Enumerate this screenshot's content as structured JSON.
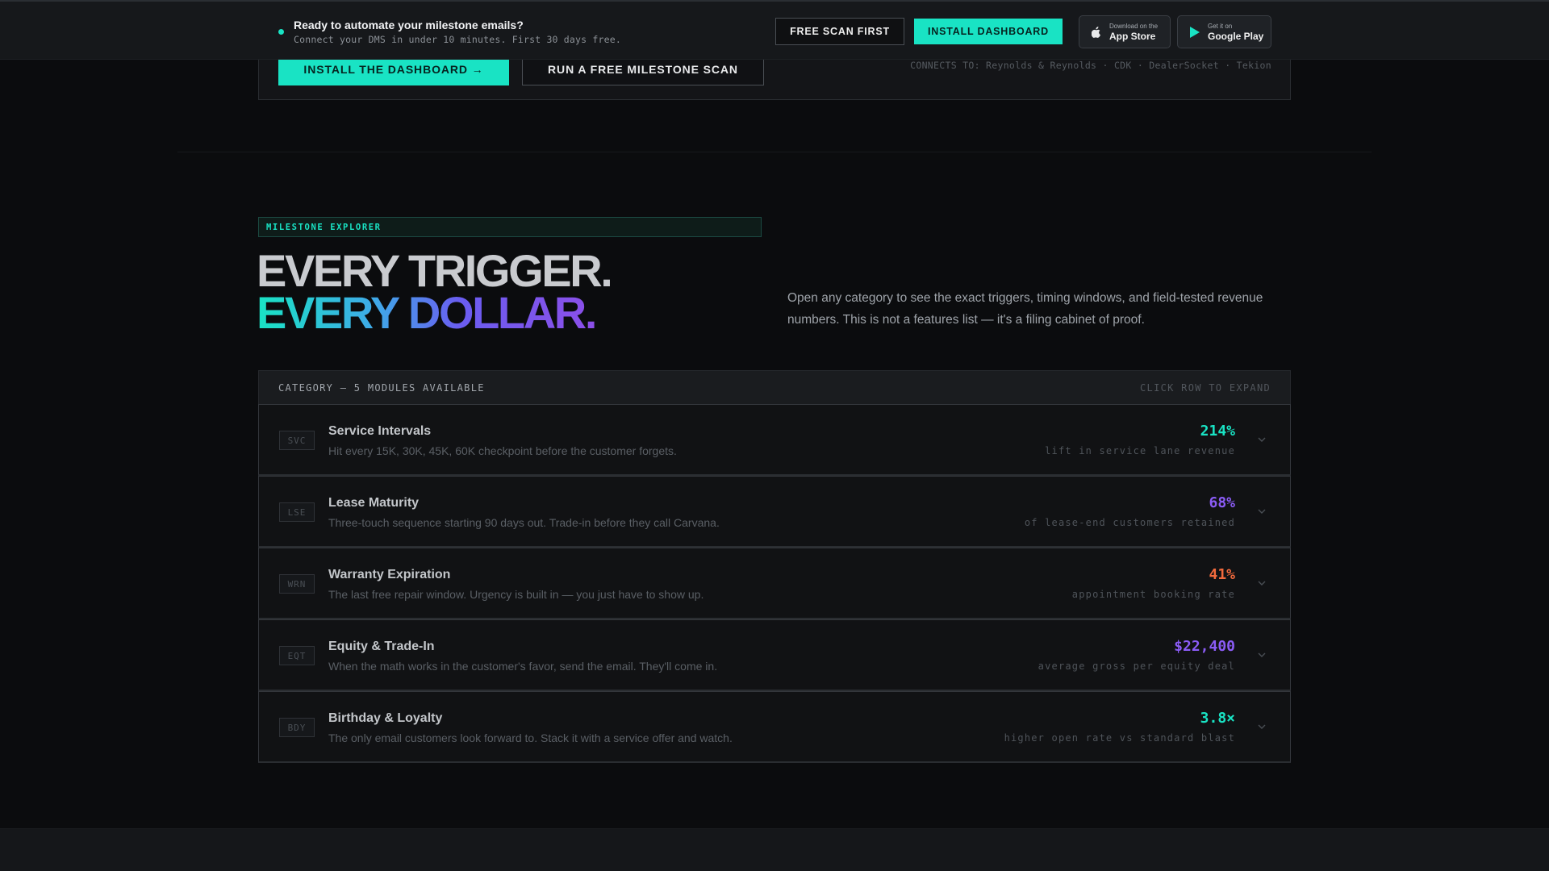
{
  "banner": {
    "title": "Ready to automate your milestone emails?",
    "subtitle": "Connect your DMS in under 10 minutes. First 30 days free.",
    "scan_button": "FREE SCAN FIRST",
    "install_button": "INSTALL DASHBOARD",
    "app_store": {
      "small": "Download on the",
      "big": "App Store"
    },
    "google_play": {
      "small": "Get it on",
      "big": "Google Play"
    }
  },
  "cta": {
    "install_label": "INSTALL THE DASHBOARD →",
    "scan_label": "RUN A FREE MILESTONE SCAN",
    "connects": "CONNECTS TO: Reynolds & Reynolds · CDK · DealerSocket · Tekion"
  },
  "explorer": {
    "tag": "MILESTONE EXPLORER",
    "headline_1": "EVERY TRIGGER.",
    "headline_2": "EVERY DOLLAR.",
    "intro": "Open any category to see the exact triggers, timing windows, and field-tested revenue numbers. This is not a features list — it's a filing cabinet of proof.",
    "table_header_left": "CATEGORY — 5 MODULES AVAILABLE",
    "table_header_right": "CLICK ROW TO EXPAND",
    "rows": [
      {
        "code": "SVC",
        "name": "Service Intervals",
        "desc": "Hit every 15K, 30K, 45K, 60K checkpoint before the customer forgets.",
        "stat": "214%",
        "stat_label": "lift in service lane revenue",
        "color": "#19e3c4"
      },
      {
        "code": "LSE",
        "name": "Lease Maturity",
        "desc": "Three-touch sequence starting 90 days out. Trade-in before they call Carvana.",
        "stat": "68%",
        "stat_label": "of lease-end customers retained",
        "color": "#8b5cf6"
      },
      {
        "code": "WRN",
        "name": "Warranty Expiration",
        "desc": "The last free repair window. Urgency is built in — you just have to show up.",
        "stat": "41%",
        "stat_label": "appointment booking rate",
        "color": "#f26a3d"
      },
      {
        "code": "EQT",
        "name": "Equity & Trade-In",
        "desc": "When the math works in the customer's favor, send the email. They'll come in.",
        "stat": "$22,400",
        "stat_label": "average gross per equity deal",
        "color": "#8b5cf6"
      },
      {
        "code": "BDY",
        "name": "Birthday & Loyalty",
        "desc": "The only email customers look forward to. Stack it with a service offer and watch.",
        "stat": "3.8×",
        "stat_label": "higher open rate vs standard blast",
        "color": "#19e3c4"
      }
    ]
  },
  "icons": {
    "status_dot": "status-dot-icon",
    "apple": "apple-icon",
    "play": "play-store-icon",
    "chevron": "chevron-down-icon"
  },
  "colors": {
    "accent": "#19e3c4",
    "violet": "#8b5cf6",
    "orange": "#f26a3d",
    "background": "#0b0c0e"
  }
}
